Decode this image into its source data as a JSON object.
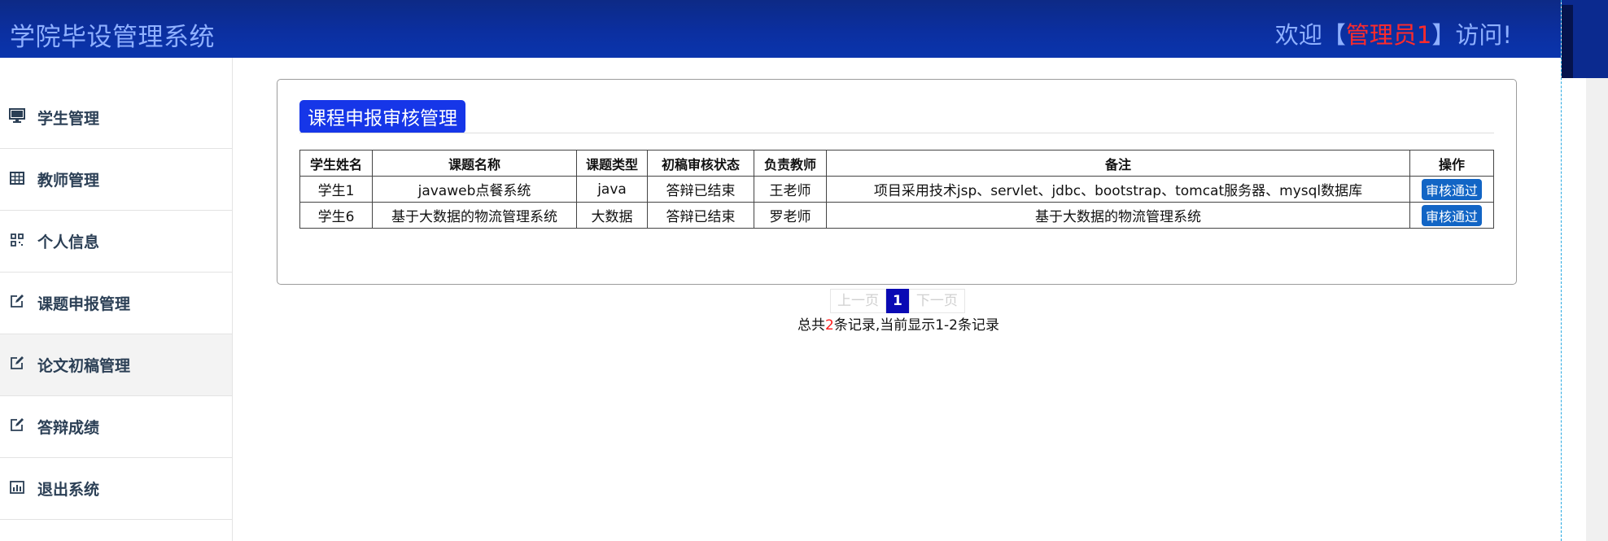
{
  "header": {
    "app_title": "学院毕设管理系统",
    "welcome_prefix": "欢迎【",
    "user_name": "管理员1",
    "welcome_suffix": "】访问!"
  },
  "sidebar": {
    "items": [
      {
        "label": "学生管理",
        "icon": "monitor-icon"
      },
      {
        "label": "教师管理",
        "icon": "table-icon"
      },
      {
        "label": "个人信息",
        "icon": "qrcode-icon"
      },
      {
        "label": "课题申报管理",
        "icon": "edit-icon"
      },
      {
        "label": "论文初稿管理",
        "icon": "edit-icon"
      },
      {
        "label": "答辩成绩",
        "icon": "edit-icon"
      },
      {
        "label": "退出系统",
        "icon": "bar-chart-icon"
      }
    ]
  },
  "main": {
    "title": "课程申报审核管理",
    "table": {
      "columns": [
        "学生姓名",
        "课题名称",
        "课题类型",
        "初稿审核状态",
        "负责教师",
        "备注",
        "操作"
      ],
      "rows": [
        {
          "student": "学生1",
          "topic": "javaweb点餐系统",
          "type": "java",
          "status": "答辩已结束",
          "teacher": "王老师",
          "remark": "项目采用技术jsp、servlet、jdbc、bootstrap、tomcat服务器、mysql数据库",
          "action": "审核通过"
        },
        {
          "student": "学生6",
          "topic": "基于大数据的物流管理系统",
          "type": "大数据",
          "status": "答辩已结束",
          "teacher": "罗老师",
          "remark": "基于大数据的物流管理系统",
          "action": "审核通过"
        }
      ]
    }
  },
  "pagination": {
    "prev": "上一页",
    "current": "1",
    "next": "下一页",
    "summary_prefix": "总共",
    "total": "2",
    "summary_suffix": "条记录,当前显示1-2条记录"
  },
  "colors": {
    "header_bg": "#0b2fa0",
    "title_badge": "#1636e8",
    "approve_button": "#1265c5",
    "highlight_red": "#ff2b2b"
  }
}
